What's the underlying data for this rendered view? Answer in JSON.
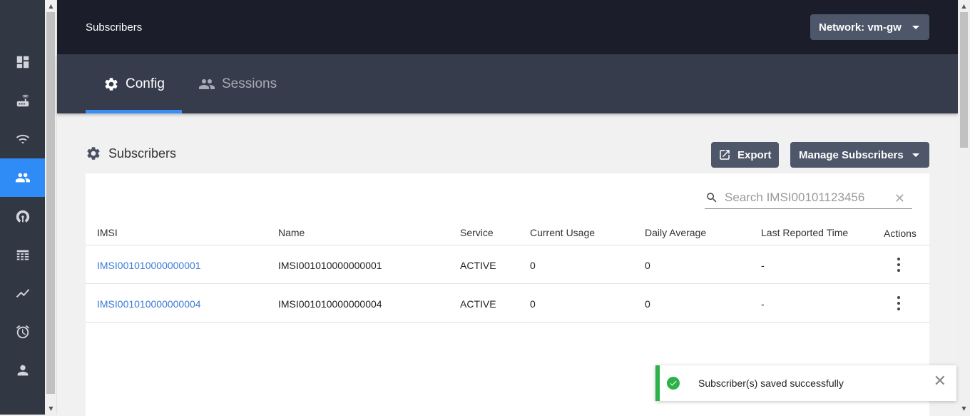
{
  "page": {
    "title": "Subscribers"
  },
  "header": {
    "network_label": "Network: vm-gw"
  },
  "tabs": [
    {
      "label": "Config",
      "icon": "gear-icon",
      "active": true
    },
    {
      "label": "Sessions",
      "icon": "people-icon",
      "active": false
    }
  ],
  "sidebar": {
    "items": [
      {
        "icon": "dashboard-icon",
        "active": false
      },
      {
        "icon": "router-icon",
        "active": false
      },
      {
        "icon": "wifi-tethering-icon",
        "active": false
      },
      {
        "icon": "people-icon",
        "active": true
      },
      {
        "icon": "signal-icon",
        "active": false
      },
      {
        "icon": "table-icon",
        "active": false
      },
      {
        "icon": "trend-icon",
        "active": false
      },
      {
        "icon": "alarm-icon",
        "active": false
      },
      {
        "icon": "person-icon",
        "active": false
      }
    ]
  },
  "section": {
    "title": "Subscribers",
    "export_label": "Export",
    "manage_label": "Manage Subscribers"
  },
  "search": {
    "placeholder": "Search IMSI00101123456"
  },
  "table": {
    "columns": [
      "IMSI",
      "Name",
      "Service",
      "Current Usage",
      "Daily Average",
      "Last Reported Time",
      "Actions"
    ],
    "rows": [
      {
        "imsi": "IMSI001010000000001",
        "name": "IMSI001010000000001",
        "service": "ACTIVE",
        "current_usage": "0",
        "daily_average": "0",
        "last_reported": "-"
      },
      {
        "imsi": "IMSI001010000000004",
        "name": "IMSI001010000000004",
        "service": "ACTIVE",
        "current_usage": "0",
        "daily_average": "0",
        "last_reported": "-"
      }
    ]
  },
  "toast": {
    "message": "Subscriber(s) saved successfully",
    "status_color": "#2db24a"
  },
  "colors": {
    "accent": "#2f8bf5",
    "link": "#3a7bd5",
    "button": "#4e5669",
    "topbar": "#1b1e2a",
    "sidebar": "#323744"
  }
}
